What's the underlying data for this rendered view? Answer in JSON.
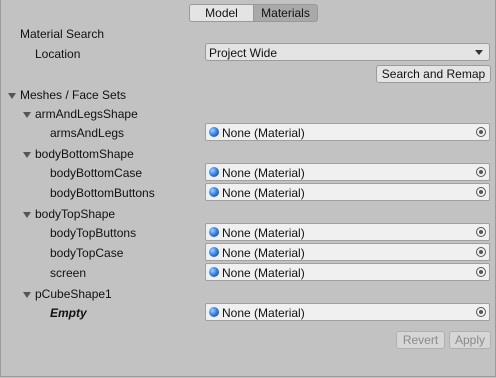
{
  "tabs": [
    "Model",
    "Materials"
  ],
  "material_search": {
    "title": "Material Search",
    "location_label": "Location",
    "location_value": "Project Wide",
    "search_remap_button": "Search and Remap"
  },
  "meshes": {
    "header": "Meshes / Face Sets",
    "groups": [
      {
        "name": "armAndLegsShape",
        "items": [
          {
            "label": "armsAndLegs",
            "value": "None (Material)"
          }
        ]
      },
      {
        "name": "bodyBottomShape",
        "items": [
          {
            "label": "bodyBottomCase",
            "value": "None (Material)"
          },
          {
            "label": "bodyBottomButtons",
            "value": "None (Material)"
          }
        ]
      },
      {
        "name": "bodyTopShape",
        "items": [
          {
            "label": "bodyTopButtons",
            "value": "None (Material)"
          },
          {
            "label": "bodyTopCase",
            "value": "None (Material)"
          },
          {
            "label": "screen",
            "value": "None (Material)"
          }
        ]
      },
      {
        "name": "pCubeShape1",
        "items": [
          {
            "label": "Empty",
            "value": "None (Material)"
          }
        ]
      }
    ]
  },
  "footer": {
    "revert": "Revert",
    "apply": "Apply"
  }
}
